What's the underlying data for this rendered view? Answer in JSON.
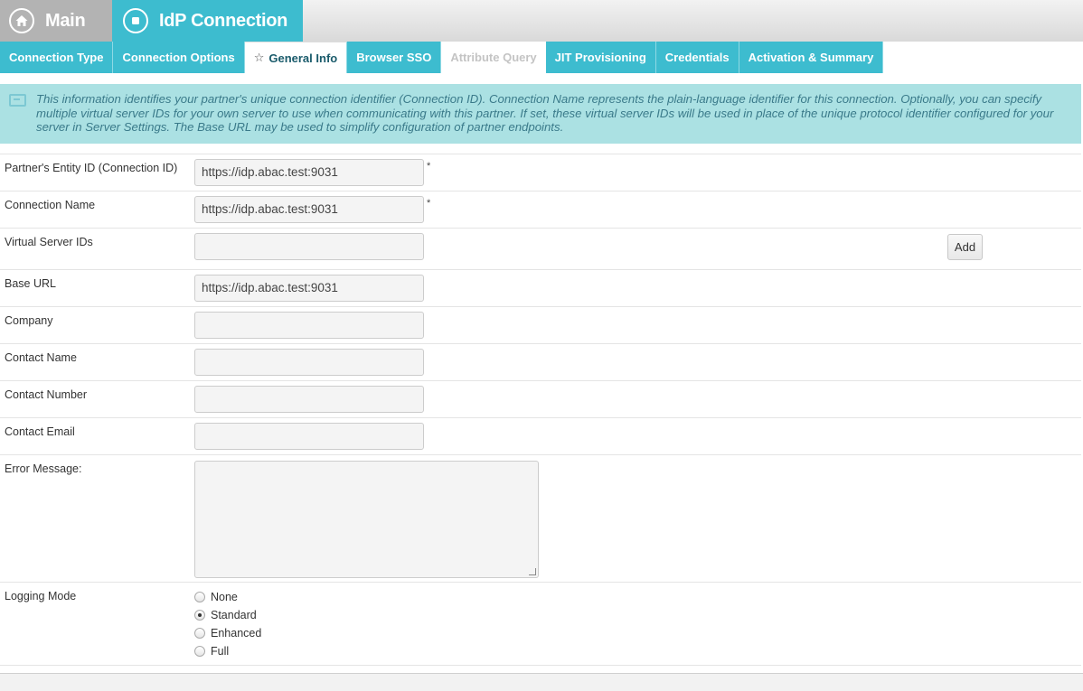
{
  "breadcrumb": {
    "main_label": "Main",
    "idp_label": "IdP Connection"
  },
  "tabs": [
    {
      "label": "Connection Type",
      "state": "normal"
    },
    {
      "label": "Connection Options",
      "state": "normal"
    },
    {
      "label": "General Info",
      "state": "active"
    },
    {
      "label": "Browser SSO",
      "state": "normal"
    },
    {
      "label": "Attribute Query",
      "state": "disabled"
    },
    {
      "label": "JIT Provisioning",
      "state": "normal"
    },
    {
      "label": "Credentials",
      "state": "normal"
    },
    {
      "label": "Activation & Summary",
      "state": "normal"
    }
  ],
  "info": {
    "text": "This information identifies your partner's unique connection identifier (Connection ID). Connection Name represents the plain-language identifier for this connection. Optionally, you can specify multiple virtual server IDs for your own server to use when communicating with this partner. If set, these virtual server IDs will be used in place of the unique protocol identifier configured for your server in Server Settings. The Base URL may be used to simplify configuration of partner endpoints."
  },
  "form": {
    "entity_id": {
      "label": "Partner's Entity ID (Connection ID)",
      "value": "https://idp.abac.test:9031",
      "required_mark": "*"
    },
    "connection_name": {
      "label": "Connection Name",
      "value": "https://idp.abac.test:9031",
      "required_mark": "*"
    },
    "virtual_server_ids": {
      "label": "Virtual Server IDs",
      "value": "",
      "add_label": "Add"
    },
    "base_url": {
      "label": "Base URL",
      "value": "https://idp.abac.test:9031"
    },
    "company": {
      "label": "Company",
      "value": ""
    },
    "contact_name": {
      "label": "Contact Name",
      "value": ""
    },
    "contact_number": {
      "label": "Contact Number",
      "value": ""
    },
    "contact_email": {
      "label": "Contact Email",
      "value": ""
    },
    "error_message": {
      "label": "Error Message:",
      "value": ""
    },
    "logging_mode": {
      "label": "Logging Mode",
      "options": [
        "None",
        "Standard",
        "Enhanced",
        "Full"
      ],
      "selected": "Standard"
    }
  },
  "colors": {
    "accent": "#3dbccf",
    "info_bg": "#abe1e3",
    "inactive_crumb": "#b3b3b3"
  },
  "icons": {
    "main": "home-icon",
    "idp": "stop-circle-icon",
    "active_tab": "star-icon",
    "info": "info-panel-icon"
  }
}
